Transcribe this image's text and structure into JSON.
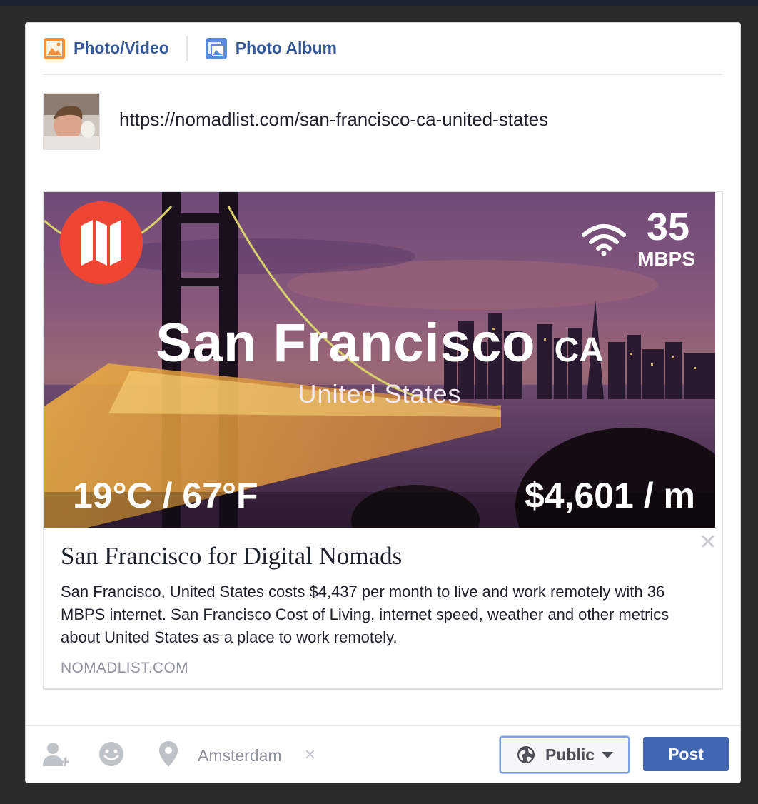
{
  "tabs": [
    {
      "label": "Photo/Video",
      "icon": "photo-video-icon"
    },
    {
      "label": "Photo Album",
      "icon": "photo-album-icon"
    }
  ],
  "status": {
    "text": "https://nomadlist.com/san-francisco-ca-united-states"
  },
  "preview": {
    "image": {
      "city": "San Francisco",
      "state": "CA",
      "country": "United States",
      "speed_value": "35",
      "speed_unit": "MBPS",
      "temperature": "19°C /  67°F",
      "cost": "$4,601 / m"
    },
    "title": "San Francisco for Digital Nomads",
    "description": "San Francisco, United States costs $4,437 per month to live and work remotely with 36 MBPS internet. San Francisco Cost of Living, internet speed, weather and other metrics about United States as a place to work remotely.",
    "domain": "NOMADLIST.COM"
  },
  "footer": {
    "location": "Amsterdam",
    "location_clear": "×",
    "privacy": "Public",
    "post": "Post"
  },
  "colors": {
    "link_blue": "#365899",
    "post_button": "#4267b2",
    "logo_red": "#f04631"
  }
}
